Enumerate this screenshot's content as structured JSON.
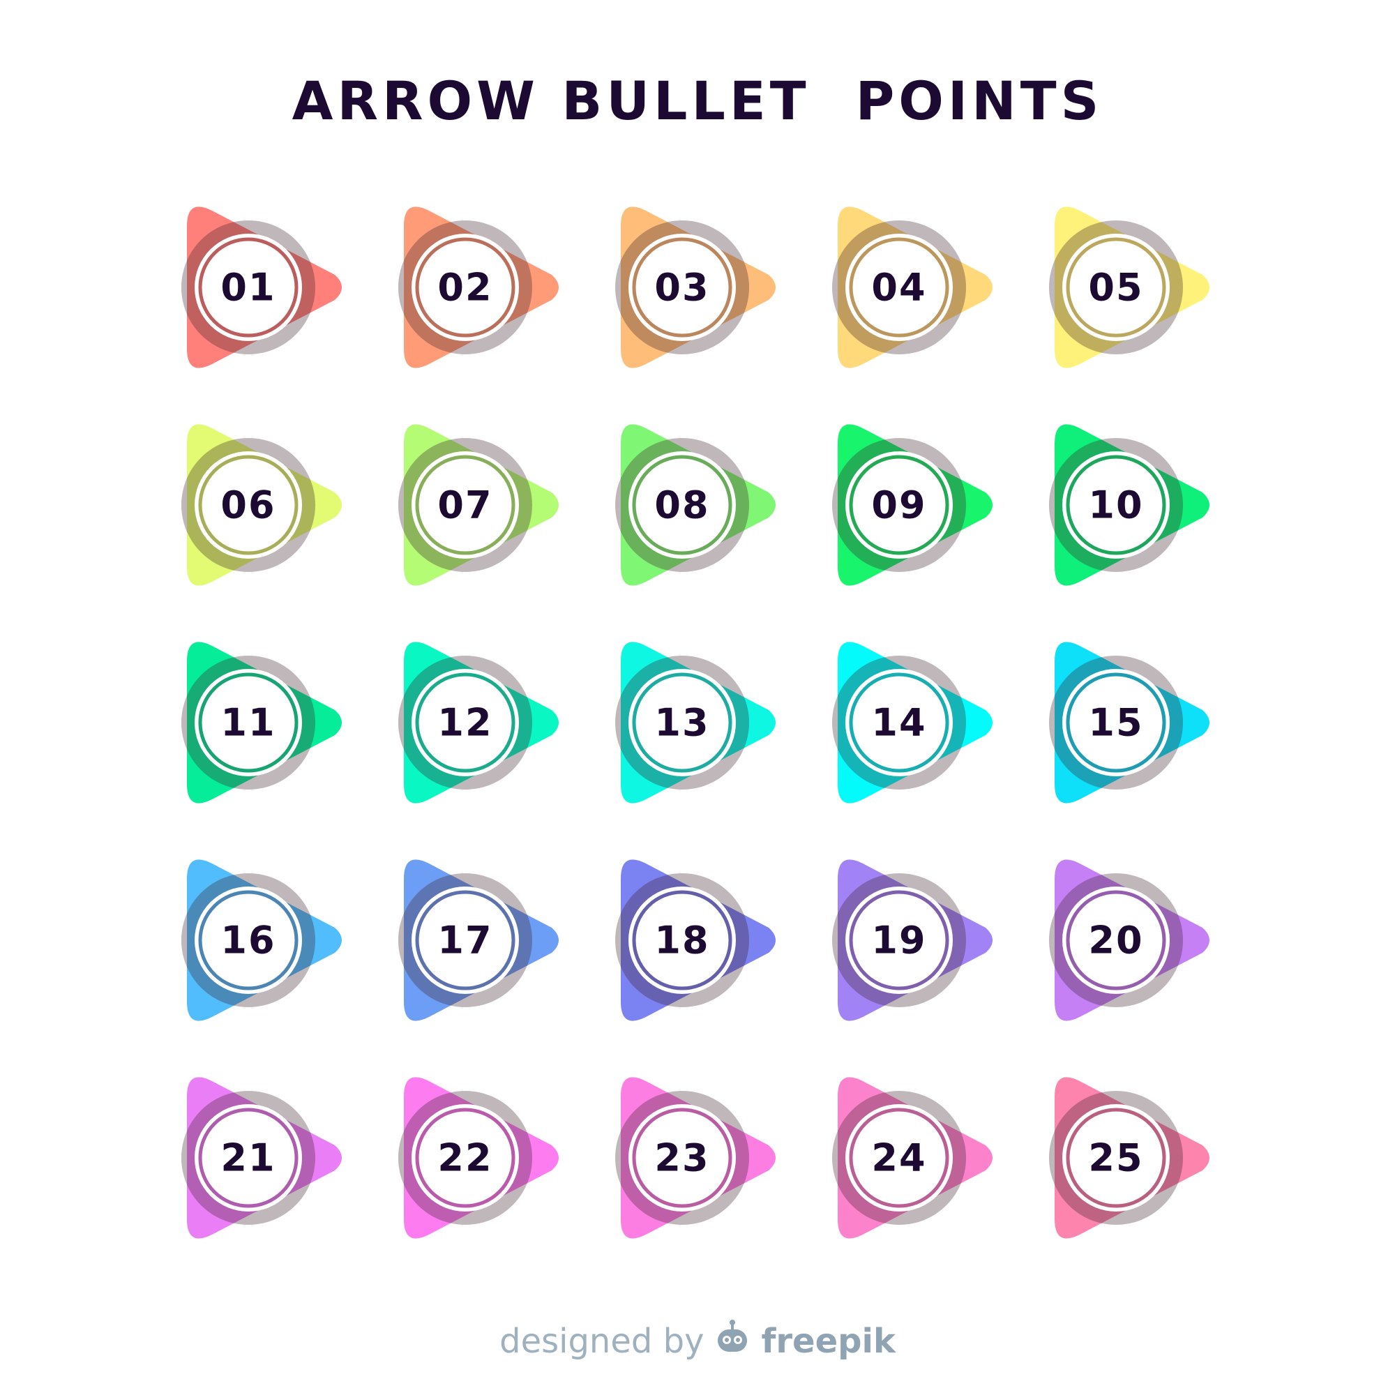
{
  "title": "ARROW BULLET  POINTS",
  "bullets": [
    {
      "label": "01",
      "color": "#ff7f7a"
    },
    {
      "label": "02",
      "color": "#ff9c77"
    },
    {
      "label": "03",
      "color": "#ffbd7a"
    },
    {
      "label": "04",
      "color": "#ffd97a"
    },
    {
      "label": "05",
      "color": "#fff27a"
    },
    {
      "label": "06",
      "color": "#e2fb72"
    },
    {
      "label": "07",
      "color": "#b3fc73"
    },
    {
      "label": "08",
      "color": "#80f774"
    },
    {
      "label": "09",
      "color": "#18f46c"
    },
    {
      "label": "10",
      "color": "#0ef07a"
    },
    {
      "label": "11",
      "color": "#06ed9a"
    },
    {
      "label": "12",
      "color": "#08f7c3"
    },
    {
      "label": "13",
      "color": "#0ef7e2"
    },
    {
      "label": "14",
      "color": "#04fbfb"
    },
    {
      "label": "15",
      "color": "#0ee0fa"
    },
    {
      "label": "16",
      "color": "#52bdfd"
    },
    {
      "label": "17",
      "color": "#6d9ef5"
    },
    {
      "label": "18",
      "color": "#7b82f2"
    },
    {
      "label": "19",
      "color": "#a283f6"
    },
    {
      "label": "20",
      "color": "#c580f6"
    },
    {
      "label": "21",
      "color": "#ea7ef6"
    },
    {
      "label": "22",
      "color": "#fd7cf0"
    },
    {
      "label": "23",
      "color": "#fd7ee3"
    },
    {
      "label": "24",
      "color": "#fd82cc"
    },
    {
      "label": "25",
      "color": "#fd84ac"
    }
  ],
  "credit": {
    "prefix": "designed by",
    "brand": "freepik"
  }
}
